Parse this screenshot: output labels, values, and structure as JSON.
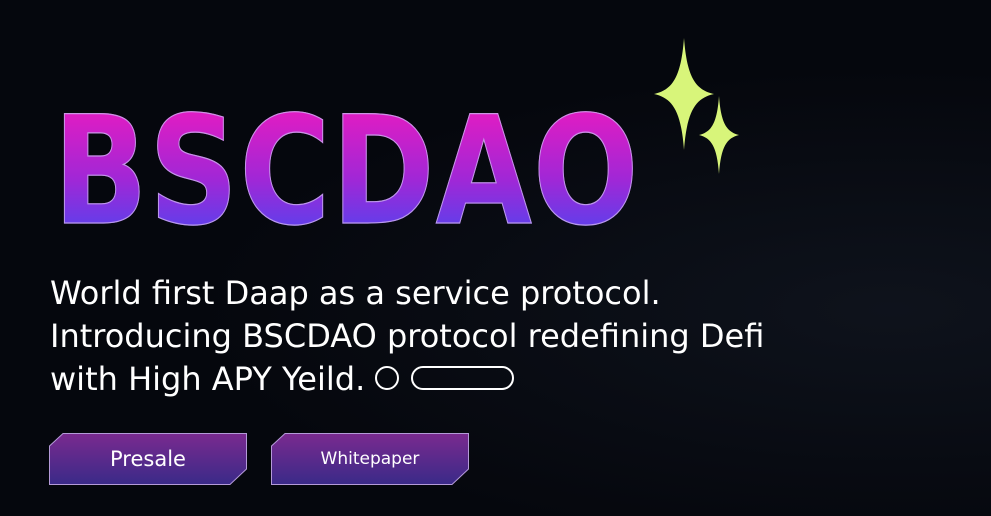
{
  "brand": {
    "title": "BSCDAO"
  },
  "tagline": {
    "line1": "World first Daap as a service protocol.",
    "line2": "Introducing BSCDAO protocol redefining Defi",
    "line3": "with High APY Yeild."
  },
  "buttons": {
    "presale_label": "Presale",
    "whitepaper_label": "Whitepaper"
  },
  "colors": {
    "background": "#05070d",
    "title_gradient_top": "#e91bc0",
    "title_gradient_bottom": "#4e45f0",
    "sparkle": "#d8f57a",
    "button_gradient_top": "#7a2a8f",
    "button_gradient_bottom": "#3a2a88"
  },
  "icons": [
    "sparkle-icon",
    "circle-icon",
    "pill-icon"
  ]
}
